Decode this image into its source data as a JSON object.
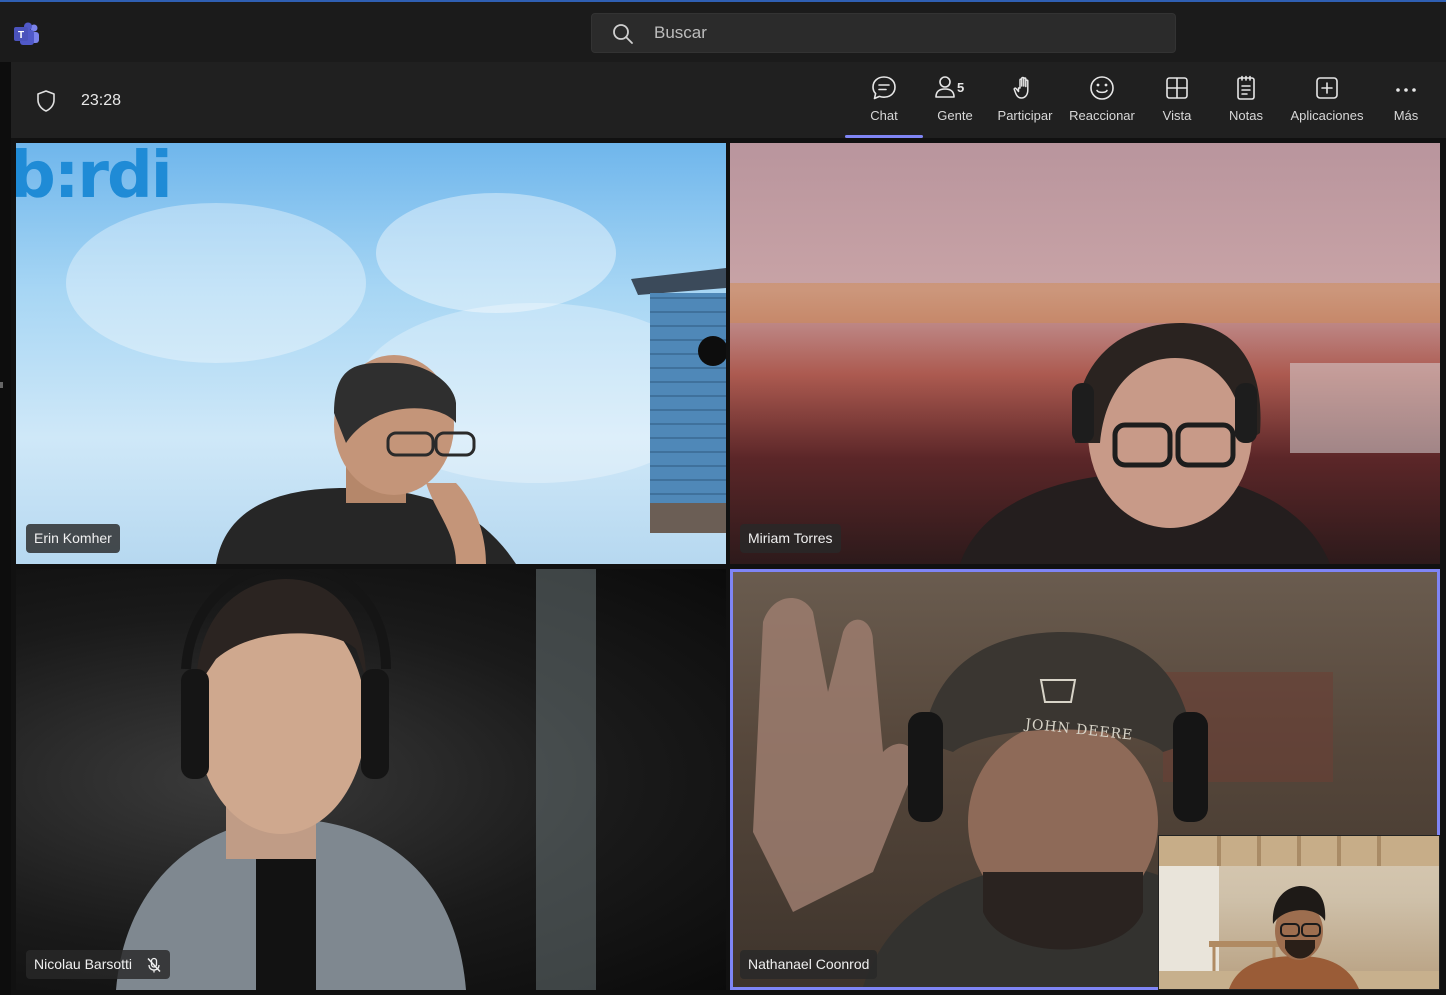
{
  "app": {
    "search_placeholder": "Buscar"
  },
  "meeting": {
    "timer": "23:28"
  },
  "toolbar": {
    "chat": "Chat",
    "people": "Gente",
    "people_count": "5",
    "raise": "Participar",
    "react": "Reaccionar",
    "view": "Vista",
    "notes": "Notas",
    "apps": "Aplicaciones",
    "more": "Más"
  },
  "participants": [
    {
      "name": "Erin Komher"
    },
    {
      "name": "Miriam Torres"
    },
    {
      "name": "Nicolau Barsotti"
    },
    {
      "name": "Nathanael Coonrod"
    }
  ],
  "tile1": {
    "logo_text": "b:rdi"
  },
  "tile4": {
    "cap_text": "JOHN DEERE"
  },
  "colors": {
    "accent": "#7f85f5",
    "brand_blue": "#2f5fb3"
  }
}
